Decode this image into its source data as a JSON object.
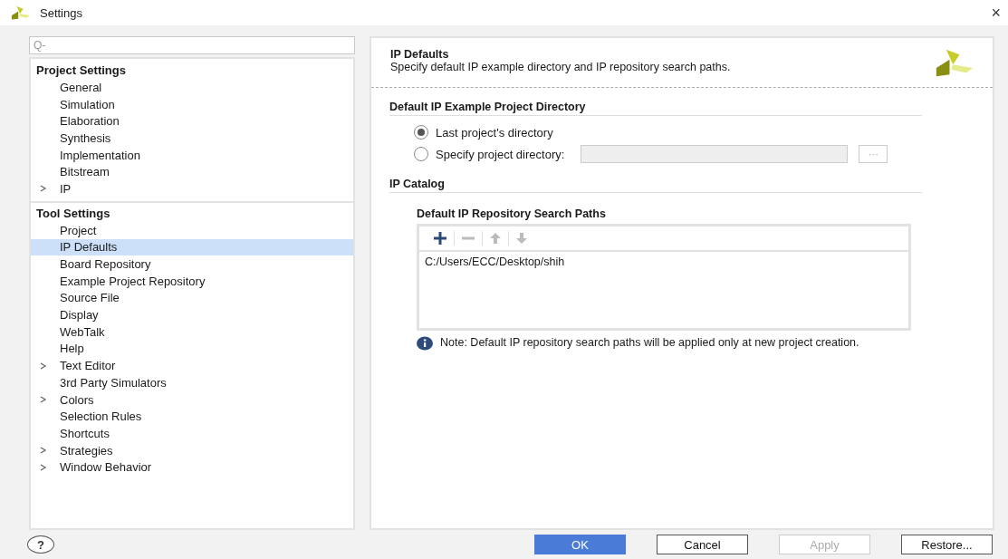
{
  "window": {
    "title": "Settings",
    "close": "×"
  },
  "sidebar": {
    "search": {
      "placeholder": "Q-"
    },
    "groups": [
      {
        "title": "Project Settings",
        "items": [
          {
            "label": "General",
            "selected": false
          },
          {
            "label": "Simulation",
            "selected": false
          },
          {
            "label": "Elaboration",
            "selected": false
          },
          {
            "label": "Synthesis",
            "selected": false
          },
          {
            "label": "Implementation",
            "selected": false
          },
          {
            "label": "Bitstream",
            "selected": false
          },
          {
            "label": "IP",
            "selected": false,
            "expanded": false
          }
        ]
      },
      {
        "title": "Tool Settings",
        "items": [
          {
            "label": "Project",
            "selected": false
          },
          {
            "label": "IP Defaults",
            "selected": true
          },
          {
            "label": "Board Repository",
            "selected": false
          },
          {
            "label": "Example Project Repository",
            "selected": false
          },
          {
            "label": "Source File",
            "selected": false
          },
          {
            "label": "Display",
            "selected": false
          },
          {
            "label": "WebTalk",
            "selected": false
          },
          {
            "label": "Help",
            "selected": false
          },
          {
            "label": "Text Editor",
            "selected": false,
            "expanded": false
          },
          {
            "label": "3rd Party Simulators",
            "selected": false
          },
          {
            "label": "Colors",
            "selected": false,
            "expanded": false
          },
          {
            "label": "Selection Rules",
            "selected": false
          },
          {
            "label": "Shortcuts",
            "selected": false
          },
          {
            "label": "Strategies",
            "selected": false,
            "expanded": false
          },
          {
            "label": "Window Behavior",
            "selected": false,
            "expanded": false
          }
        ]
      }
    ]
  },
  "page": {
    "title": "IP Defaults",
    "description": "Specify default IP example directory and IP repository search paths.",
    "example_section": {
      "title": "Default IP Example Project Directory",
      "options": [
        {
          "label": "Last project's directory",
          "selected": true
        },
        {
          "label": "Specify project directory:",
          "selected": false
        }
      ],
      "directory_field": {
        "disabled": true
      },
      "browse_button": "···"
    },
    "catalog_section": {
      "title": "IP Catalog",
      "paths_title": "Default IP Repository Search Paths",
      "toolbar": [
        {
          "kind": "add",
          "disabled": false
        },
        {
          "kind": "remove",
          "disabled": true
        },
        {
          "kind": "up",
          "disabled": true
        },
        {
          "kind": "down",
          "disabled": true
        }
      ],
      "paths": [
        "C:/Users/ECC/Desktop/shih"
      ],
      "note": "Note: Default IP repository search paths will be applied only at new project creation."
    }
  },
  "buttons": [
    {
      "label": "OK",
      "kind": "primary",
      "disabled": false
    },
    {
      "label": "Cancel",
      "kind": "normal",
      "disabled": false
    },
    {
      "label": "Apply",
      "kind": "normal",
      "disabled": true
    },
    {
      "label": "Restore...",
      "kind": "normal",
      "disabled": false
    }
  ],
  "help": "?"
}
